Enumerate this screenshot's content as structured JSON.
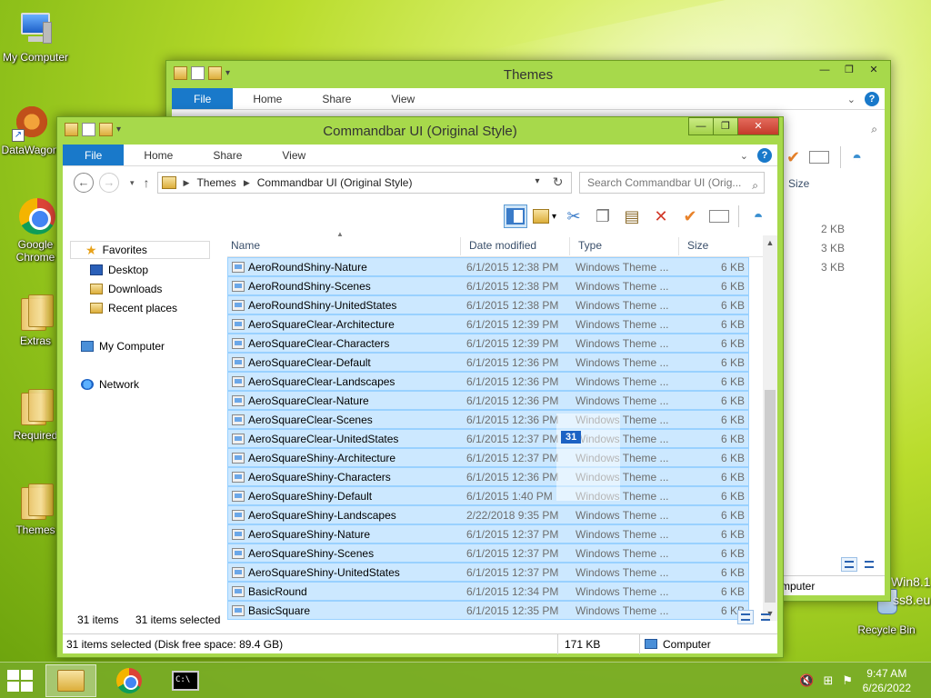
{
  "desktop": {
    "icons": [
      {
        "label": "My Computer"
      },
      {
        "label": "DataWagon"
      },
      {
        "label": "Google Chrome"
      },
      {
        "label": "Extras"
      },
      {
        "label": "Required"
      },
      {
        "label": "Themes"
      },
      {
        "label": "Recycle Bin"
      }
    ],
    "watermark": [
      "Win8.1",
      "ss8.eu"
    ]
  },
  "back_window": {
    "title": "Themes",
    "tabs": [
      "File",
      "Home",
      "Share",
      "View"
    ],
    "column_size": "Size",
    "sizes": [
      "2 KB",
      "3 KB",
      "3 KB"
    ],
    "status_text": "mputer"
  },
  "front_window": {
    "title": "Commandbar UI (Original Style)",
    "tabs": [
      "File",
      "Home",
      "Share",
      "View"
    ],
    "breadcrumb": [
      "Themes",
      "Commandbar UI (Original Style)"
    ],
    "search_placeholder": "Search Commandbar UI (Orig...",
    "nav": {
      "favorites": "Favorites",
      "desktop": "Desktop",
      "downloads": "Downloads",
      "recent": "Recent places",
      "computer": "My Computer",
      "network": "Network"
    },
    "columns": {
      "name": "Name",
      "date": "Date modified",
      "type": "Type",
      "size": "Size"
    },
    "files": [
      {
        "name": "AeroRoundShiny-Nature",
        "date": "6/1/2015 12:38 PM",
        "type": "Windows Theme ...",
        "size": "6 KB"
      },
      {
        "name": "AeroRoundShiny-Scenes",
        "date": "6/1/2015 12:38 PM",
        "type": "Windows Theme ...",
        "size": "6 KB"
      },
      {
        "name": "AeroRoundShiny-UnitedStates",
        "date": "6/1/2015 12:38 PM",
        "type": "Windows Theme ...",
        "size": "6 KB"
      },
      {
        "name": "AeroSquareClear-Architecture",
        "date": "6/1/2015 12:39 PM",
        "type": "Windows Theme ...",
        "size": "6 KB"
      },
      {
        "name": "AeroSquareClear-Characters",
        "date": "6/1/2015 12:39 PM",
        "type": "Windows Theme ...",
        "size": "6 KB"
      },
      {
        "name": "AeroSquareClear-Default",
        "date": "6/1/2015 12:36 PM",
        "type": "Windows Theme ...",
        "size": "6 KB"
      },
      {
        "name": "AeroSquareClear-Landscapes",
        "date": "6/1/2015 12:36 PM",
        "type": "Windows Theme ...",
        "size": "6 KB"
      },
      {
        "name": "AeroSquareClear-Nature",
        "date": "6/1/2015 12:36 PM",
        "type": "Windows Theme ...",
        "size": "6 KB"
      },
      {
        "name": "AeroSquareClear-Scenes",
        "date": "6/1/2015 12:36 PM",
        "type": "Windows Theme ...",
        "size": "6 KB"
      },
      {
        "name": "AeroSquareClear-UnitedStates",
        "date": "6/1/2015 12:37 PM",
        "type": "Windows Theme ...",
        "size": "6 KB"
      },
      {
        "name": "AeroSquareShiny-Architecture",
        "date": "6/1/2015 12:37 PM",
        "type": "Windows Theme ...",
        "size": "6 KB"
      },
      {
        "name": "AeroSquareShiny-Characters",
        "date": "6/1/2015 12:36 PM",
        "type": "Windows Theme ...",
        "size": "6 KB"
      },
      {
        "name": "AeroSquareShiny-Default",
        "date": "6/1/2015 1:40 PM",
        "type": "Windows Theme ...",
        "size": "6 KB"
      },
      {
        "name": "AeroSquareShiny-Landscapes",
        "date": "2/22/2018 9:35 PM",
        "type": "Windows Theme ...",
        "size": "6 KB"
      },
      {
        "name": "AeroSquareShiny-Nature",
        "date": "6/1/2015 12:37 PM",
        "type": "Windows Theme ...",
        "size": "6 KB"
      },
      {
        "name": "AeroSquareShiny-Scenes",
        "date": "6/1/2015 12:37 PM",
        "type": "Windows Theme ...",
        "size": "6 KB"
      },
      {
        "name": "AeroSquareShiny-UnitedStates",
        "date": "6/1/2015 12:37 PM",
        "type": "Windows Theme ...",
        "size": "6 KB"
      },
      {
        "name": "BasicRound",
        "date": "6/1/2015 12:34 PM",
        "type": "Windows Theme ...",
        "size": "6 KB"
      },
      {
        "name": "BasicSquare",
        "date": "6/1/2015 12:35 PM",
        "type": "Windows Theme ...",
        "size": "6 KB"
      }
    ],
    "drag_count": "31",
    "status_items": "31 items",
    "status_selected": "31 items selected",
    "footer_selection": "31 items selected (Disk free space: 89.4 GB)",
    "footer_size": "171 KB",
    "footer_location": "Computer"
  },
  "taskbar": {
    "time": "9:47 AM",
    "date": "6/26/2022"
  },
  "colors": {
    "accent": "#1979ca",
    "selection": "#cce8ff",
    "frame": "#a7d94b"
  }
}
